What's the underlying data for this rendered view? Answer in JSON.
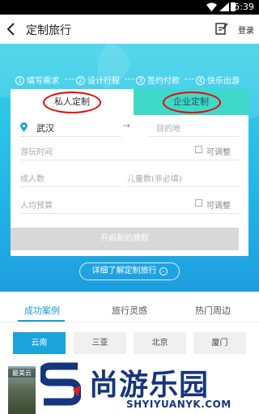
{
  "status_bar": {
    "time": "5:39"
  },
  "nav": {
    "title": "定制旅行",
    "login": "登录"
  },
  "steps": [
    {
      "num": "1",
      "label": "填写需求"
    },
    {
      "num": "2",
      "label": "设计行程"
    },
    {
      "num": "3",
      "label": "签约付款"
    },
    {
      "num": "4",
      "label": "快乐出游"
    }
  ],
  "form": {
    "tabs": {
      "private": "私人定制",
      "enterprise": "企业定制"
    },
    "origin_city": "武汉",
    "destination_placeholder": "目的地",
    "time_placeholder": "游玩时间",
    "adjustable_label": "可调整",
    "adults_placeholder": "成人数",
    "children_placeholder": "儿童数(非必填)",
    "budget_placeholder": "人均预算",
    "start_button": "开启新的旅程"
  },
  "detail_button": "详细了解定制旅行",
  "section_tabs": [
    {
      "label": "成功案例",
      "active": true
    },
    {
      "label": "旅行灵感",
      "active": false
    },
    {
      "label": "热门周边",
      "active": false
    }
  ],
  "city_chips": [
    {
      "label": "云南",
      "active": true
    },
    {
      "label": "三亚",
      "active": false
    },
    {
      "label": "北京",
      "active": false
    },
    {
      "label": "厦门",
      "active": false
    }
  ],
  "thumbnail_label": "最美云",
  "watermark": {
    "chinese": "尚游乐园",
    "english": "SHYIYUANYK.COM"
  },
  "colors": {
    "accent": "#1a9bd7",
    "enterprise_tab": "#3fd8c9",
    "highlight_ring": "#e00000"
  }
}
